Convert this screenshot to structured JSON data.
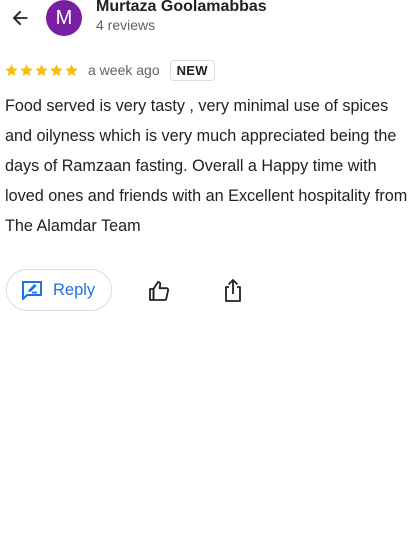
{
  "header": {
    "back_icon": "arrow-back-icon",
    "avatar_initial": "M",
    "avatar_color": "#7b1fa2",
    "reviewer_name": "Murtaza Goolamabbas",
    "review_count": "4 reviews"
  },
  "review": {
    "rating": 5,
    "rating_max": 5,
    "star_color": "#fbbc04",
    "time": "a week ago",
    "badge": "NEW",
    "text": "Food served is very tasty , very minimal use of spices and oilyness which is very much appreciated being the days of Ramzaan fasting. Overall a Happy time with loved ones and friends with an Excellent hospitality from The Alamdar Team"
  },
  "actions": {
    "reply_label": "Reply",
    "reply_icon": "reply-icon",
    "like_icon": "thumbs-up-icon",
    "share_icon": "share-icon",
    "accent_color": "#1a73e8"
  }
}
